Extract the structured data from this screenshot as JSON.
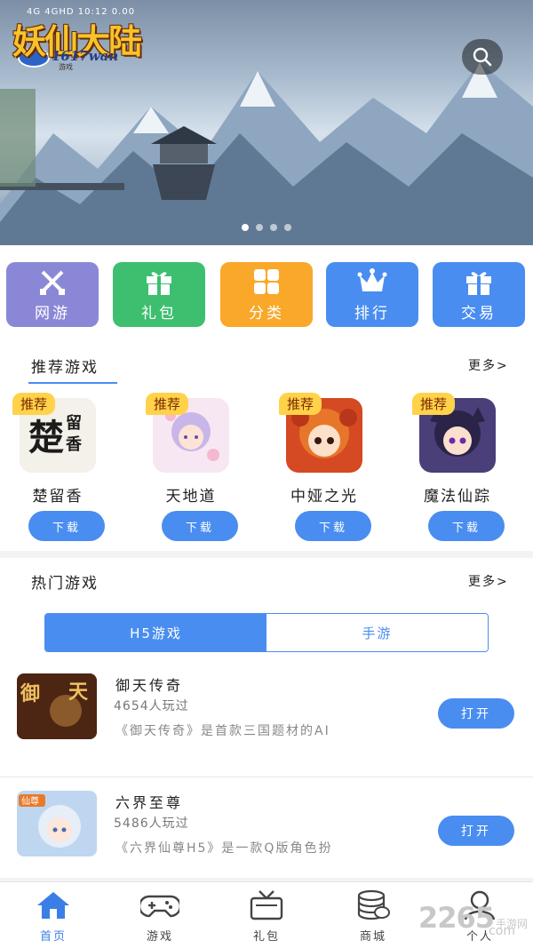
{
  "colors": {
    "primary": "#4a8df0",
    "tag": "#ffd24a"
  },
  "status": {
    "signal": "4G  4GHD  10:12  0.00"
  },
  "banner": {
    "logo_title": "妖仙大陆",
    "logo_sub": "1617wan",
    "logo_small": "游戏",
    "search_icon": "search-icon",
    "dots": 4,
    "active_dot": 0
  },
  "categories": [
    {
      "label": "网游",
      "icon": "swords-icon",
      "color": "#8a88d6"
    },
    {
      "label": "礼包",
      "icon": "gift-icon",
      "color": "#3dbf6f"
    },
    {
      "label": "分类",
      "icon": "grid-icon",
      "color": "#f9a82a"
    },
    {
      "label": "排行",
      "icon": "crown-icon",
      "color": "#4a8df0"
    },
    {
      "label": "交易",
      "icon": "gift-icon",
      "color": "#4a8df0"
    }
  ],
  "recommend": {
    "title": "推荐游戏",
    "more": "更多>",
    "tag": "推荐",
    "download": "下载",
    "games": [
      {
        "name": "楚留香",
        "icon_text": "楚留香"
      },
      {
        "name": "天地道",
        "icon_text": ""
      },
      {
        "name": "中娅之光",
        "icon_text": ""
      },
      {
        "name": "魔法仙踪",
        "icon_text": ""
      }
    ]
  },
  "hot": {
    "title": "热门游戏",
    "more": "更多>",
    "tabs": [
      "H5游戏",
      "手游"
    ],
    "active_tab": 0,
    "open": "打开",
    "items": [
      {
        "title": "御天传奇",
        "count": "4654人玩过",
        "desc": "《御天传奇》是首款三国题材的AI",
        "icon_text": "御天"
      },
      {
        "title": "六界至尊",
        "count": "5486人玩过",
        "desc": "《六界仙尊H5》是一款Q版角色扮",
        "icon_text": "仙尊"
      }
    ]
  },
  "tabbar": [
    {
      "label": "首页",
      "icon": "home-icon",
      "active": true
    },
    {
      "label": "游戏",
      "icon": "gamepad-icon",
      "active": false
    },
    {
      "label": "礼包",
      "icon": "tv-gift-icon",
      "active": false
    },
    {
      "label": "商城",
      "icon": "coins-icon",
      "active": false
    },
    {
      "label": "个人",
      "icon": "user-icon",
      "active": false
    }
  ],
  "watermark": {
    "big": "2265",
    "small": "手游网",
    "tail": ".com"
  }
}
